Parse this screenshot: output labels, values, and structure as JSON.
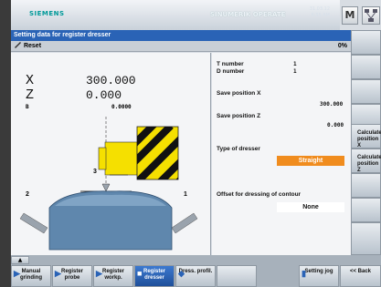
{
  "header": {
    "brand": "SIEMENS",
    "product": "SINUMERIK OPERATE",
    "date": "31.03.12",
    "time": "8:35 AM",
    "m_icon_label": "M"
  },
  "title": "Setting data for register dresser",
  "status": {
    "reset": "Reset",
    "percent": "0%"
  },
  "axes": [
    {
      "name": "X",
      "value": "300.000"
    },
    {
      "name": "Z",
      "value": "0.000"
    },
    {
      "name": "B",
      "value": "0.0000"
    }
  ],
  "diagram": {
    "label_1": "1",
    "label_2": "2",
    "label_3": "3"
  },
  "fields": {
    "t_number_label": "T number",
    "t_number_value": "1",
    "d_number_label": "D number",
    "d_number_value": "1",
    "save_x_label": "Save position X",
    "save_x_value": "300.000",
    "save_z_label": "Save position Z",
    "save_z_value": "0.000",
    "dresser_type_label": "Type of dresser",
    "dresser_type_value": "Straight",
    "offset_label": "Offset for dressing of contour",
    "offset_value": "None"
  },
  "vertical_softkeys": [
    "",
    "",
    "",
    "",
    "Calculate position X",
    "Calculate position Z",
    "",
    "",
    ""
  ],
  "horizontal_softkeys": [
    {
      "label": "Manual grinding",
      "icon": "manual-icon"
    },
    {
      "label": "Register probe",
      "icon": "probe-icon"
    },
    {
      "label": "Register workp.",
      "icon": "workpiece-icon"
    },
    {
      "label": "Register dresser",
      "icon": "dresser-icon",
      "active": true
    },
    {
      "label": "Dress. profil.",
      "icon": "profile-icon"
    },
    {
      "label": "",
      "icon": ""
    },
    {
      "label": "Setting jog",
      "icon": "setting-icon"
    },
    {
      "label": "<< Back",
      "icon": ""
    }
  ],
  "colors": {
    "title_bar": "#2a63b6",
    "orange_field": "#f08c1e",
    "hazard_yellow": "#f5e000",
    "machine_blue": "#5f87ad"
  }
}
